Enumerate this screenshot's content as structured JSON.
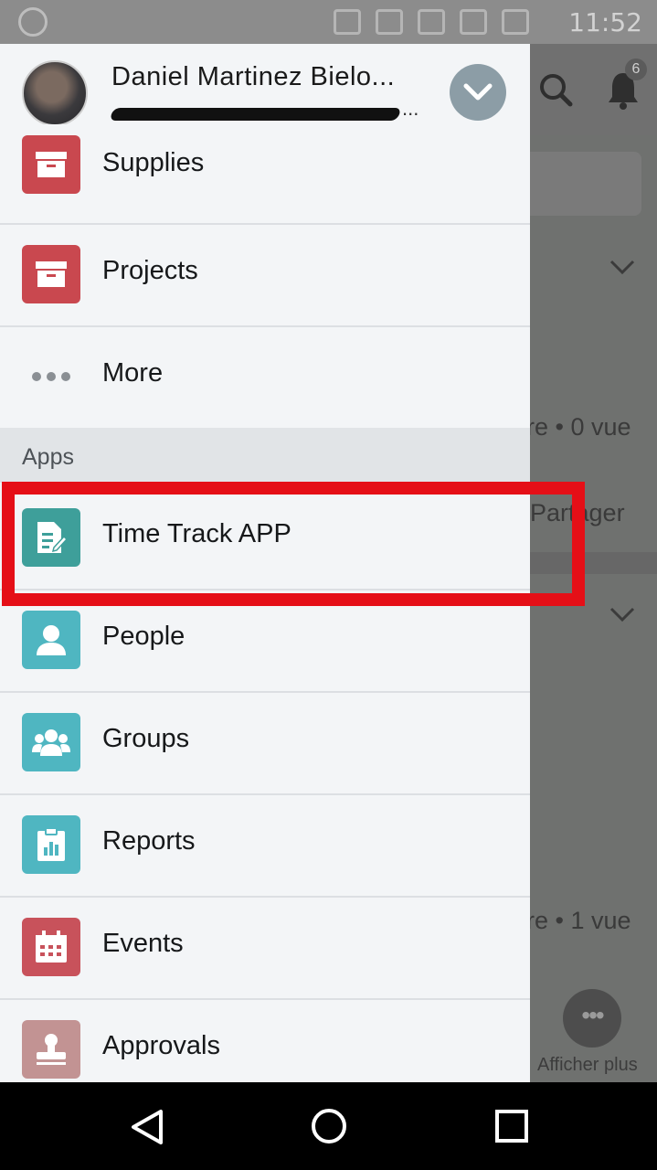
{
  "status_bar": {
    "time": "11:52"
  },
  "background_app": {
    "notification_count": "6",
    "snippet_1": "re • 0 vue",
    "snippet_2": "Partager",
    "snippet_3": "re • 1 vue",
    "more_label": "Afficher plus"
  },
  "drawer": {
    "user": {
      "name": "Daniel Martinez Bielo..."
    },
    "items_top": [
      {
        "label": "Supplies",
        "icon": "archive-icon",
        "color": "#c9484f"
      },
      {
        "label": "Projects",
        "icon": "archive-icon",
        "color": "#c9484f"
      },
      {
        "label": "More",
        "icon": "ellipsis-icon"
      }
    ],
    "section_label": "Apps",
    "apps": [
      {
        "label": "Time Track APP",
        "icon": "document-edit-icon",
        "color": "#3e9f9a"
      },
      {
        "label": "People",
        "icon": "person-icon",
        "color": "#4fb6c1"
      },
      {
        "label": "Groups",
        "icon": "group-icon",
        "color": "#4fb6c1"
      },
      {
        "label": "Reports",
        "icon": "report-icon",
        "color": "#4fb6c1"
      },
      {
        "label": "Events",
        "icon": "calendar-icon",
        "color": "#c8525b"
      },
      {
        "label": "Approvals",
        "icon": "stamp-icon",
        "color": "#c29393"
      }
    ]
  },
  "highlight_color": "#e50f17"
}
